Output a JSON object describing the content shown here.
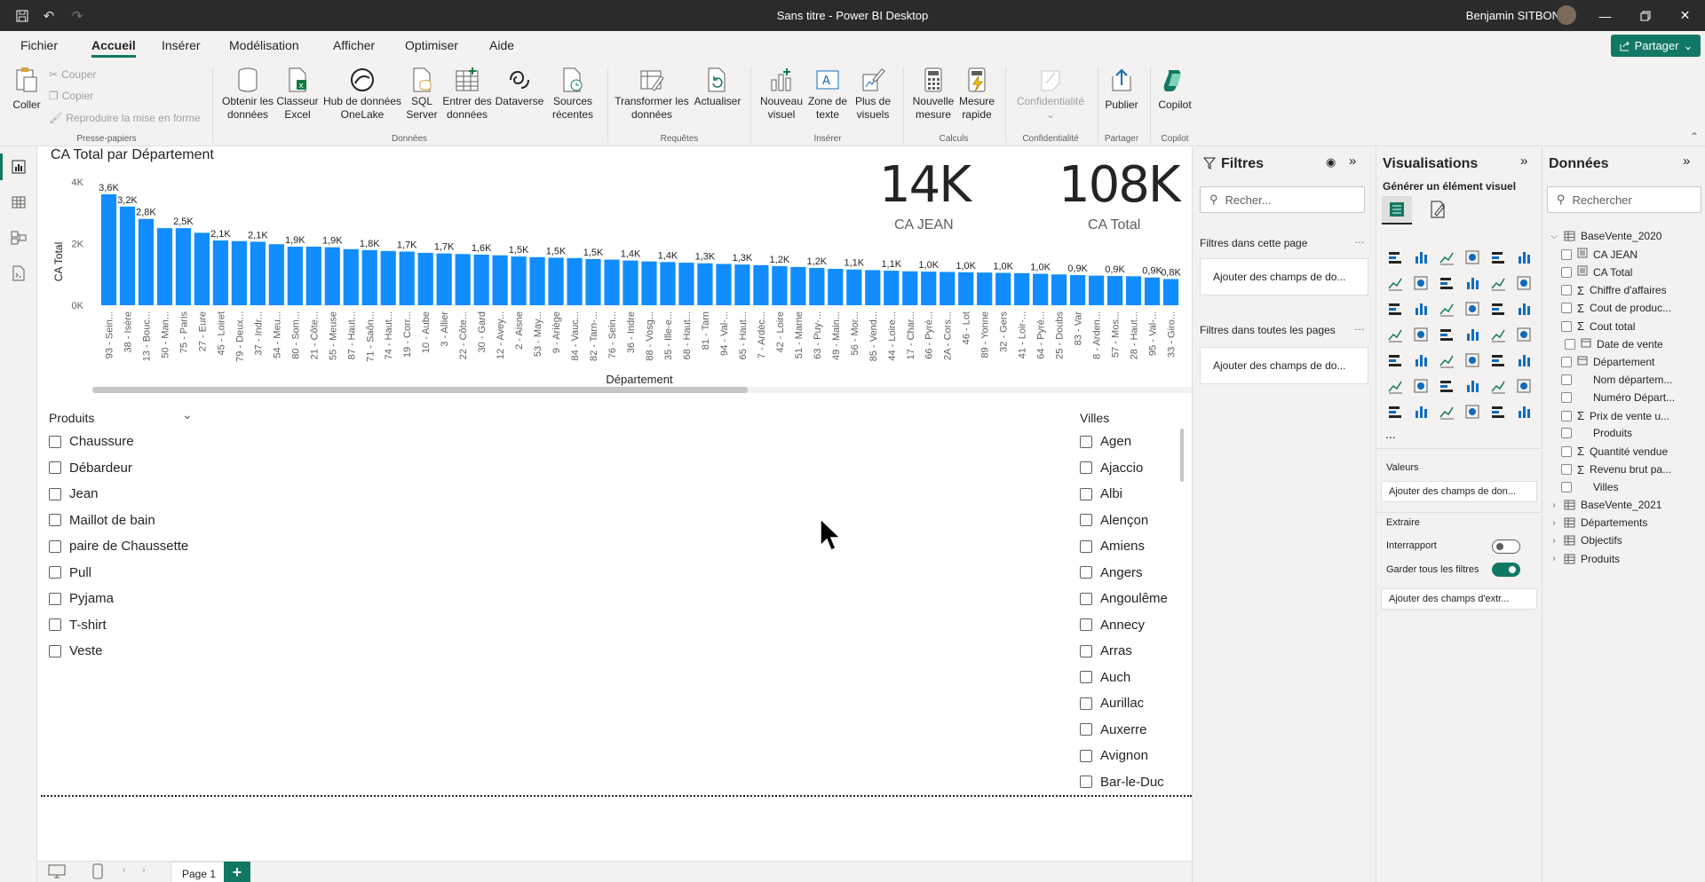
{
  "window": {
    "title": "Sans titre - Power BI Desktop",
    "user": "Benjamin SITBON"
  },
  "menu": {
    "tabs": [
      "Fichier",
      "Accueil",
      "Insérer",
      "Modélisation",
      "Afficher",
      "Optimiser",
      "Aide"
    ],
    "active": "Accueil",
    "share_label": "Partager"
  },
  "ribbon": {
    "clipboard": {
      "paste": "Coller",
      "cut": "Couper",
      "copy": "Copier",
      "format_painter": "Reproduire la mise en forme",
      "group": "Presse-papiers"
    },
    "data": {
      "get_data": "Obtenir les données",
      "excel": "Classeur Excel",
      "onelake": "Hub de données OneLake",
      "sql": "SQL Server",
      "enter_data": "Entrer des données",
      "dataverse": "Dataverse",
      "recent": "Sources récentes",
      "group": "Données"
    },
    "queries": {
      "transform": "Transformer les données",
      "refresh": "Actualiser",
      "group": "Requêtes"
    },
    "insert": {
      "new_visual": "Nouveau visuel",
      "text_box": "Zone de texte",
      "more_visuals": "Plus de visuels",
      "group": "Insérer"
    },
    "calc": {
      "new_measure": "Nouvelle mesure",
      "quick_measure": "Mesure rapide",
      "group": "Calculs"
    },
    "sensitivity": {
      "label": "Confidentialité",
      "group": "Confidentialité"
    },
    "share": {
      "publish": "Publier",
      "group": "Partager"
    },
    "copilot": {
      "label": "Copilot",
      "group": "Copilot"
    }
  },
  "chart_data": {
    "type": "bar",
    "title": "CA Total par Département",
    "xlabel": "Département",
    "ylabel": "CA Total",
    "y_ticks": [
      "0K",
      "2K",
      "4K"
    ],
    "ylim": [
      0,
      4000
    ],
    "color": "#118DFF",
    "categories": [
      "93 - Sein...",
      "38 - Isère",
      "13 - Bouc...",
      "50 - Man...",
      "75 - Paris",
      "27 - Eure",
      "45 - Loiret",
      "79 - Deux...",
      "37 - Indr...",
      "54 - Meu...",
      "80 - Som...",
      "21 - Côte...",
      "55 - Meuse",
      "87 - Haut...",
      "71 - Saôn...",
      "74 - Haut...",
      "19 - Corr...",
      "10 - Aube",
      "3 - Allier",
      "22 - Côte...",
      "30 - Gard",
      "12 - Avey...",
      "2 - Aisne",
      "53 - May...",
      "9 - Ariège",
      "84 - Vauc...",
      "82 - Tarn-...",
      "76 - Sein...",
      "36 - Indre",
      "88 - Vosg...",
      "35 - Ille-e...",
      "68 - Haut...",
      "81 - Tarn",
      "94 - Val-...",
      "65 - Haut...",
      "7 - Ardèc...",
      "42 - Loire",
      "51 - Marne",
      "63 - Puy-...",
      "49 - Main...",
      "56 - Mor...",
      "85 - Vend...",
      "44 - Loire...",
      "17 - Char...",
      "66 - Pyré...",
      "2A - Cors...",
      "46 - Lot",
      "89 - Yonne",
      "32 - Gers",
      "41 - Loir-...",
      "64 - Pyré...",
      "25 - Doubs",
      "83 - Var",
      "8 - Arden...",
      "57 - Mos...",
      "28 - Haut...",
      "95 - Val-...",
      "33 - Giro..."
    ],
    "values": [
      3600,
      3200,
      2800,
      2500,
      2500,
      2350,
      2100,
      2080,
      2060,
      1980,
      1900,
      1900,
      1880,
      1820,
      1790,
      1760,
      1740,
      1700,
      1680,
      1660,
      1640,
      1620,
      1580,
      1560,
      1540,
      1530,
      1500,
      1480,
      1450,
      1420,
      1400,
      1380,
      1360,
      1340,
      1320,
      1300,
      1270,
      1240,
      1210,
      1180,
      1160,
      1140,
      1120,
      1100,
      1090,
      1080,
      1070,
      1060,
      1050,
      1040,
      1020,
      1000,
      980,
      960,
      950,
      940,
      900,
      850
    ],
    "data_labels": {
      "0": "3,6K",
      "1": "3,2K",
      "2": "2,8K",
      "4": "2,5K",
      "6": "2,1K",
      "8": "2,1K",
      "10": "1,9K",
      "12": "1,9K",
      "14": "1,8K",
      "16": "1,7K",
      "18": "1,7K",
      "20": "1,6K",
      "22": "1,5K",
      "24": "1,5K",
      "26": "1,5K",
      "28": "1,4K",
      "30": "1,4K",
      "32": "1,3K",
      "34": "1,3K",
      "36": "1,2K",
      "38": "1,2K",
      "40": "1,1K",
      "42": "1,1K",
      "44": "1,0K",
      "46": "1,0K",
      "48": "1,0K",
      "50": "1,0K",
      "52": "0,9K",
      "54": "0,9K",
      "56": "0,9K",
      "57": "0,8K"
    },
    "scroll_position": 0.58
  },
  "kpis": [
    {
      "value": "14K",
      "label": "CA JEAN"
    },
    {
      "value": "108K",
      "label": "CA Total"
    }
  ],
  "slicer_produits": {
    "title": "Produits",
    "items": [
      "Chaussure",
      "Débardeur",
      "Jean",
      "Maillot de bain",
      "paire de Chaussette",
      "Pull",
      "Pyjama",
      "T-shirt",
      "Veste"
    ]
  },
  "slicer_villes": {
    "title": "Villes",
    "items": [
      "Agen",
      "Ajaccio",
      "Albi",
      "Alençon",
      "Amiens",
      "Angers",
      "Angoulême",
      "Annecy",
      "Arras",
      "Auch",
      "Aurillac",
      "Auxerre",
      "Avignon",
      "Bar-le-Duc"
    ]
  },
  "pages": {
    "tabs": [
      "Page 1"
    ],
    "add": "+"
  },
  "filters": {
    "title": "Filtres",
    "search_placeholder": "Recher...",
    "this_page": "Filtres dans cette page",
    "all_pages": "Filtres dans toutes les pages",
    "add_fields": "Ajouter des champs de do..."
  },
  "visualizations": {
    "title": "Visualisations",
    "build": "Générer un élément visuel",
    "values_label": "Valeurs",
    "add_fields": "Ajouter des champs de don...",
    "drill": "Extraire",
    "cross_report": "Interrapport",
    "keep_filters": "Garder tous les filtres",
    "add_drill": "Ajouter des champs d'extr...",
    "more": "...",
    "icons": [
      "stacked-bar",
      "stacked-column",
      "clustered-bar",
      "clustered-column",
      "100-bar",
      "100-column",
      "line",
      "area",
      "stacked-area",
      "ribbon",
      "waterfall",
      "line-column",
      "line-stacked",
      "funnel",
      "scatter",
      "pie",
      "donut",
      "treemap",
      "map",
      "filled-map",
      "shape-map",
      "azure-map",
      "gauge",
      "card",
      "multi-card",
      "kpi",
      "slicer",
      "table",
      "matrix",
      "r-visual",
      "python",
      "key-influencers",
      "decomposition",
      "qa",
      "narrative",
      "paginated",
      "metrics",
      "power-apps",
      "power-automate",
      "arcgis",
      "diamond",
      "chevron"
    ]
  },
  "data": {
    "title": "Données",
    "search_placeholder": "Rechercher",
    "tables": [
      {
        "name": "BaseVente_2020",
        "expanded": true,
        "fields": [
          {
            "name": "CA JEAN",
            "kind": "measure"
          },
          {
            "name": "CA Total",
            "kind": "measure"
          },
          {
            "name": "Chiffre d'affaires",
            "kind": "sum"
          },
          {
            "name": "Cout de produc...",
            "kind": "sum"
          },
          {
            "name": "Cout total",
            "kind": "sum"
          },
          {
            "name": "Date de vente",
            "kind": "date"
          },
          {
            "name": "Département",
            "kind": "hier"
          },
          {
            "name": "Nom départem...",
            "kind": "text"
          },
          {
            "name": "Numéro Départ...",
            "kind": "text"
          },
          {
            "name": "Prix de vente u...",
            "kind": "sum"
          },
          {
            "name": "Produits",
            "kind": "text"
          },
          {
            "name": "Quantité vendue",
            "kind": "sum"
          },
          {
            "name": "Revenu brut pa...",
            "kind": "sum"
          },
          {
            "name": "Villes",
            "kind": "text"
          }
        ]
      },
      {
        "name": "BaseVente_2021",
        "expanded": false
      },
      {
        "name": "Départements",
        "expanded": false
      },
      {
        "name": "Objectifs",
        "expanded": false
      },
      {
        "name": "Produits",
        "expanded": false
      }
    ]
  }
}
